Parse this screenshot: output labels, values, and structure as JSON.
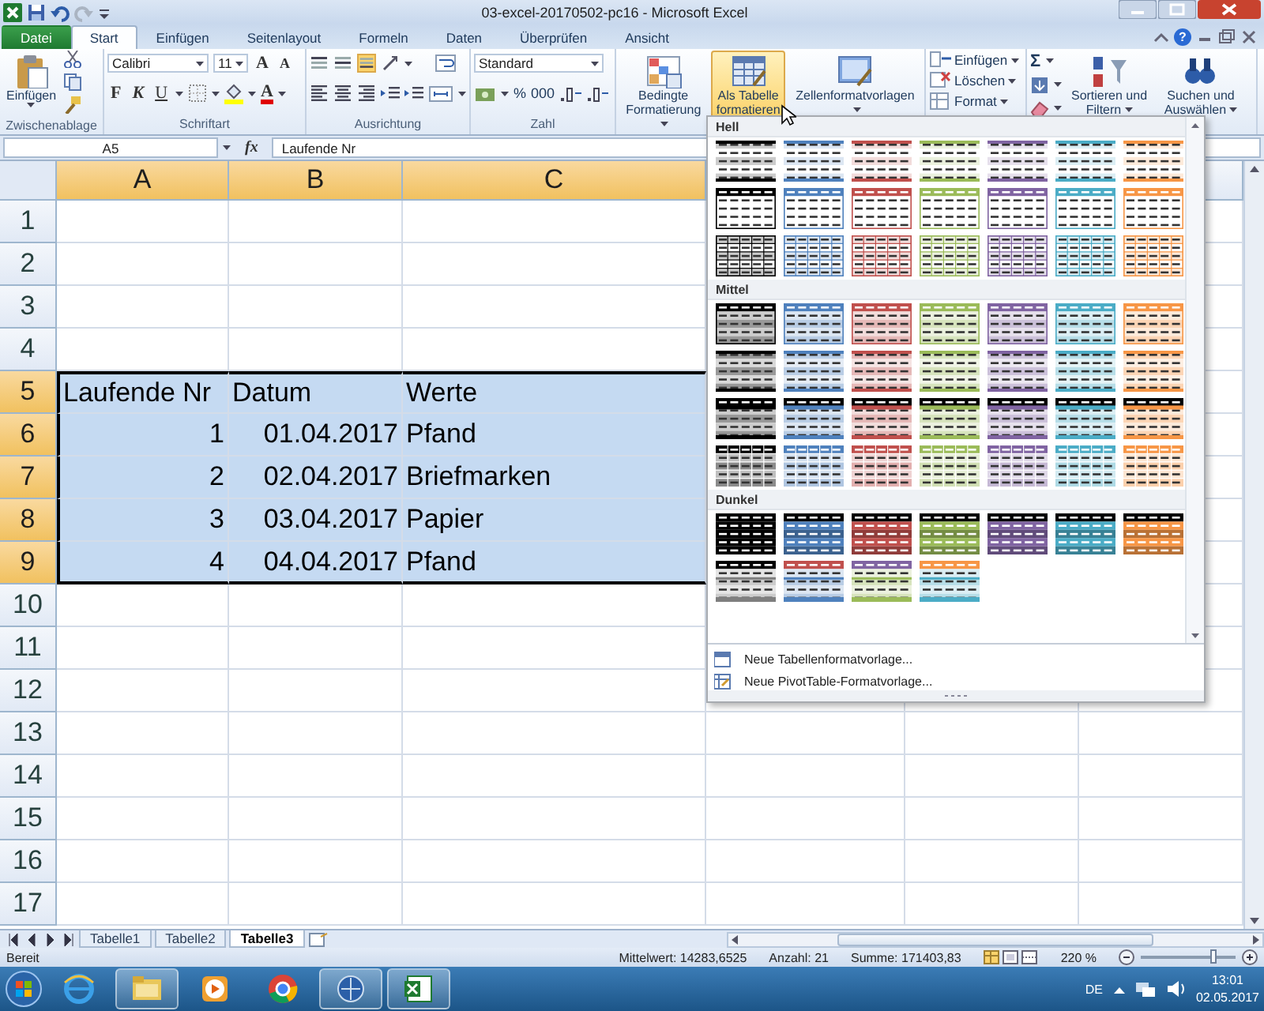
{
  "window": {
    "title": "03-excel-20170502-pc16 - Microsoft Excel",
    "help": "?"
  },
  "tabs": [
    {
      "label": "Datei",
      "kind": "file",
      "selected": false
    },
    {
      "label": "Start",
      "kind": "tab",
      "selected": true
    },
    {
      "label": "Einfügen",
      "kind": "tab",
      "selected": false
    },
    {
      "label": "Seitenlayout",
      "kind": "tab",
      "selected": false
    },
    {
      "label": "Formeln",
      "kind": "tab",
      "selected": false
    },
    {
      "label": "Daten",
      "kind": "tab",
      "selected": false
    },
    {
      "label": "Überprüfen",
      "kind": "tab",
      "selected": false
    },
    {
      "label": "Ansicht",
      "kind": "tab",
      "selected": false
    }
  ],
  "ribbon": {
    "clipboard": {
      "paste": "Einfügen",
      "label": "Zwischenablage"
    },
    "font": {
      "name": "Calibri",
      "size": "11",
      "grow": "A",
      "shrink": "A",
      "bold": "F",
      "italic": "K",
      "underline": "U",
      "font_color": "A",
      "label": "Schriftart"
    },
    "alignment": {
      "label": "Ausrichtung"
    },
    "number": {
      "format": "Standard",
      "percent": "%",
      "thousands": "000",
      "label": "Zahl"
    },
    "styles": [
      {
        "label": "Bedingte Formatierung",
        "selected": false
      },
      {
        "label": "Als Tabelle formatieren",
        "selected": true
      },
      {
        "label": "Zellenformatvorlagen",
        "selected": false
      }
    ],
    "cells": [
      "Einfügen",
      "Löschen",
      "Format"
    ],
    "editing": {
      "sum": "Σ",
      "sort": "Sortieren und Filtern",
      "find": "Suchen und Auswählen"
    }
  },
  "formula_bar": {
    "name_box": "A5",
    "function_label": "fx",
    "value": "Laufende Nr"
  },
  "sheet": {
    "columns": [
      {
        "label": "A",
        "selected": true
      },
      {
        "label": "B",
        "selected": true
      },
      {
        "label": "C",
        "selected": true
      }
    ],
    "rows": [
      {
        "label": "1",
        "selected": false
      },
      {
        "label": "2",
        "selected": false
      },
      {
        "label": "3",
        "selected": false
      },
      {
        "label": "4",
        "selected": false
      },
      {
        "label": "5",
        "selected": true,
        "cells": [
          {
            "text": "Laufende Nr",
            "kind": "text"
          },
          {
            "text": "Datum",
            "kind": "text"
          },
          {
            "text": "Werte",
            "kind": "text"
          }
        ]
      },
      {
        "label": "6",
        "selected": true,
        "cells": [
          {
            "text": "1",
            "kind": "number"
          },
          {
            "text": "01.04.2017",
            "kind": "number"
          },
          {
            "text": "Pfand",
            "kind": "text"
          }
        ]
      },
      {
        "label": "7",
        "selected": true,
        "cells": [
          {
            "text": "2",
            "kind": "number"
          },
          {
            "text": "02.04.2017",
            "kind": "number"
          },
          {
            "text": "Briefmarken",
            "kind": "text"
          }
        ]
      },
      {
        "label": "8",
        "selected": true,
        "cells": [
          {
            "text": "3",
            "kind": "number"
          },
          {
            "text": "03.04.2017",
            "kind": "number"
          },
          {
            "text": "Papier",
            "kind": "text"
          }
        ]
      },
      {
        "label": "9",
        "selected": true,
        "cells": [
          {
            "text": "4",
            "kind": "number"
          },
          {
            "text": "04.04.2017",
            "kind": "number"
          },
          {
            "text": "Pfand",
            "kind": "text"
          }
        ]
      },
      {
        "label": "10",
        "selected": false
      },
      {
        "label": "11",
        "selected": false
      },
      {
        "label": "12",
        "selected": false
      },
      {
        "label": "13",
        "selected": false
      },
      {
        "label": "14",
        "selected": false
      },
      {
        "label": "15",
        "selected": false
      },
      {
        "label": "16",
        "selected": false
      },
      {
        "label": "17",
        "selected": false
      }
    ]
  },
  "gallery": {
    "sections": [
      {
        "title": "Hell",
        "rows": [
          {
            "kind": "lines",
            "items": [
              {
                "color": "#000000"
              },
              {
                "color": "#4f81bd"
              },
              {
                "color": "#c0504d"
              },
              {
                "color": "#9bbb59"
              },
              {
                "color": "#8064a2"
              },
              {
                "color": "#4bacc6"
              },
              {
                "color": "#f79646"
              }
            ]
          },
          {
            "kind": "header",
            "items": [
              {
                "color": "#000000"
              },
              {
                "color": "#4f81bd"
              },
              {
                "color": "#c0504d"
              },
              {
                "color": "#9bbb59"
              },
              {
                "color": "#8064a2"
              },
              {
                "color": "#4bacc6"
              },
              {
                "color": "#f79646"
              }
            ]
          },
          {
            "kind": "grid",
            "items": [
              {
                "color": "#000000"
              },
              {
                "color": "#4f81bd"
              },
              {
                "color": "#c0504d"
              },
              {
                "color": "#9bbb59"
              },
              {
                "color": "#8064a2"
              },
              {
                "color": "#4bacc6"
              },
              {
                "color": "#f79646"
              }
            ]
          }
        ]
      },
      {
        "title": "Mittel",
        "rows": [
          {
            "kind": "medium_header",
            "items": [
              {
                "color": "#000000"
              },
              {
                "color": "#4f81bd"
              },
              {
                "color": "#c0504d"
              },
              {
                "color": "#9bbb59"
              },
              {
                "color": "#8064a2"
              },
              {
                "color": "#4bacc6"
              },
              {
                "color": "#f79646"
              }
            ]
          },
          {
            "kind": "medium_banded",
            "items": [
              {
                "color": "#000000"
              },
              {
                "color": "#4f81bd"
              },
              {
                "color": "#c0504d"
              },
              {
                "color": "#9bbb59"
              },
              {
                "color": "#8064a2"
              },
              {
                "color": "#4bacc6"
              },
              {
                "color": "#f79646"
              }
            ]
          },
          {
            "kind": "medium_black_header",
            "items": [
              {
                "color": "#000000"
              },
              {
                "color": "#4f81bd"
              },
              {
                "color": "#c0504d"
              },
              {
                "color": "#9bbb59"
              },
              {
                "color": "#8064a2"
              },
              {
                "color": "#4bacc6"
              },
              {
                "color": "#f79646"
              }
            ]
          },
          {
            "kind": "medium_grid",
            "items": [
              {
                "color": "#000000"
              },
              {
                "color": "#4f81bd"
              },
              {
                "color": "#c0504d"
              },
              {
                "color": "#9bbb59"
              },
              {
                "color": "#8064a2"
              },
              {
                "color": "#4bacc6"
              },
              {
                "color": "#f79646"
              }
            ]
          }
        ]
      },
      {
        "title": "Dunkel",
        "rows": [
          {
            "kind": "dark",
            "items": [
              {
                "color": "#000000"
              },
              {
                "color": "#4f81bd"
              },
              {
                "color": "#c0504d"
              },
              {
                "color": "#9bbb59"
              },
              {
                "color": "#8064a2"
              },
              {
                "color": "#4bacc6"
              },
              {
                "color": "#f79646"
              }
            ]
          },
          {
            "kind": "dark_contrast",
            "items": [
              {
                "color": "#000000"
              },
              {
                "color": "#c0504d"
              },
              {
                "color": "#8064a2"
              },
              {
                "color": "#f79646"
              }
            ]
          }
        ]
      }
    ],
    "commands": [
      "Neue Tabellenformatvorlage...",
      "Neue PivotTable-Formatvorlage..."
    ]
  },
  "sheet_tabs": [
    {
      "label": "Tabelle1",
      "selected": false
    },
    {
      "label": "Tabelle2",
      "selected": false
    },
    {
      "label": "Tabelle3",
      "selected": true
    }
  ],
  "status_bar": {
    "mode": "Bereit",
    "average": "Mittelwert: 14283,6525",
    "count": "Anzahl: 21",
    "sum": "Summe: 171403,83",
    "zoom": "220 %",
    "zoom_slider": {
      "level": 0.78
    }
  },
  "taskbar": {
    "apps": [
      {
        "kind": "browser_e",
        "running": false
      },
      {
        "kind": "folder",
        "running": true
      },
      {
        "kind": "media",
        "running": false
      },
      {
        "kind": "chrome",
        "running": false
      },
      {
        "kind": "remote",
        "running": true
      },
      {
        "kind": "spreadsheet",
        "running": true
      }
    ],
    "language": "DE",
    "time": "13:01",
    "date": "02.05.2017"
  }
}
